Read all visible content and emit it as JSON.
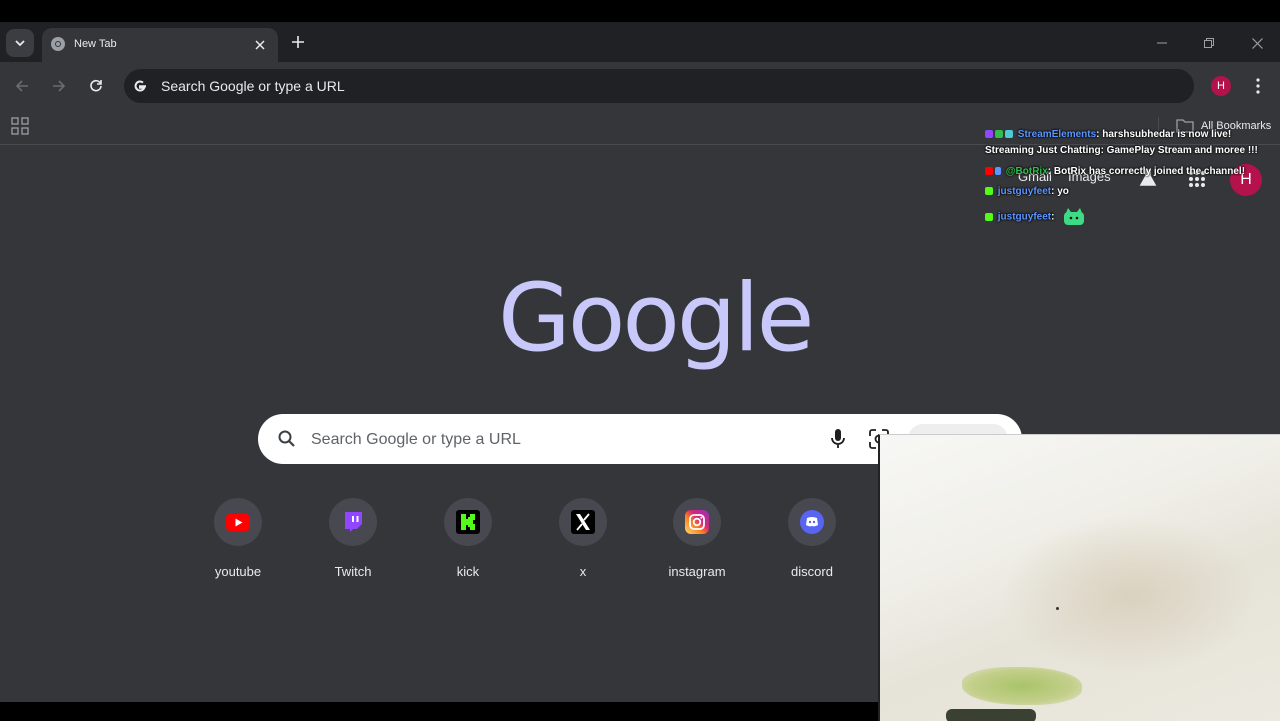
{
  "tab": {
    "title": "New Tab"
  },
  "omnibox": {
    "text": "Search Google or type a URL"
  },
  "profile": {
    "initial": "H"
  },
  "bookmarks": {
    "all_label": "All Bookmarks"
  },
  "ntp": {
    "links": [
      "Gmail",
      "Images"
    ],
    "avatar_initial": "H",
    "logo": "Google",
    "search_placeholder": "Search Google or type a URL",
    "shortcuts": [
      {
        "label": "youtube",
        "icon": "youtube-icon"
      },
      {
        "label": "Twitch",
        "icon": "twitch-icon"
      },
      {
        "label": "kick",
        "icon": "kick-icon"
      },
      {
        "label": "x",
        "icon": "x-icon"
      },
      {
        "label": "instagram",
        "icon": "instagram-icon"
      },
      {
        "label": "discord",
        "icon": "discord-icon"
      }
    ]
  },
  "chat": {
    "lines": [
      {
        "user": "StreamElements",
        "msg": ": harshsubhedar is now live!"
      },
      {
        "user": "",
        "msg": "Streaming Just Chatting: GamePlay Stream and moree !!!"
      },
      {
        "user": "@BotRix",
        "msg": ": BotRix has correctly joined the channel!"
      },
      {
        "user": "justguyfeet",
        "msg": ": yo"
      },
      {
        "user": "justguyfeet",
        "msg": ":"
      }
    ]
  },
  "colors": {
    "background": "#35363a",
    "tabstrip": "#202124",
    "logo": "#c8c8fa",
    "avatar": "#b3124b",
    "chat_user": "#5b95ff"
  }
}
